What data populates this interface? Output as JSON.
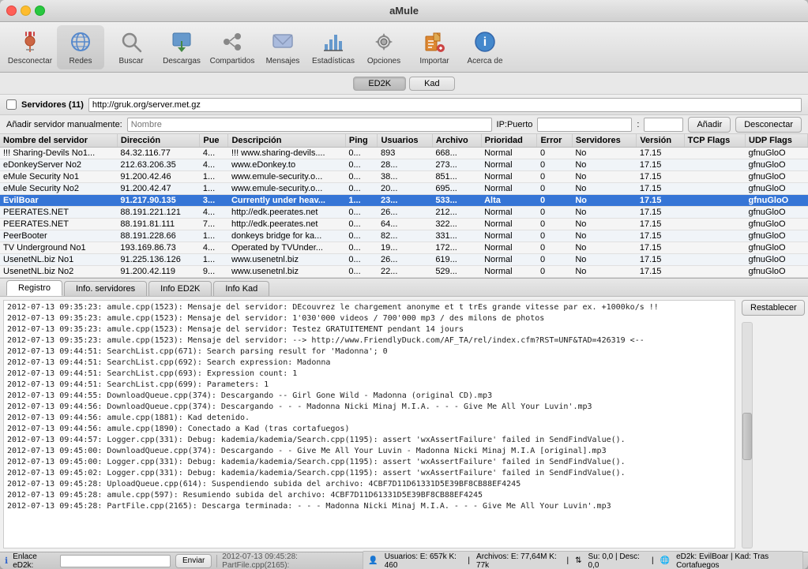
{
  "window": {
    "title": "aMule"
  },
  "toolbar": {
    "buttons": [
      {
        "id": "desconectar",
        "label": "Desconectar",
        "icon": "plug-icon"
      },
      {
        "id": "redes",
        "label": "Redes",
        "icon": "network-icon"
      },
      {
        "id": "buscar",
        "label": "Buscar",
        "icon": "search-icon"
      },
      {
        "id": "descargas",
        "label": "Descargas",
        "icon": "download-icon"
      },
      {
        "id": "compartidos",
        "label": "Compartidos",
        "icon": "shared-icon"
      },
      {
        "id": "mensajes",
        "label": "Mensajes",
        "icon": "messages-icon"
      },
      {
        "id": "estadisticas",
        "label": "Estadísticas",
        "icon": "stats-icon"
      },
      {
        "id": "opciones",
        "label": "Opciones",
        "icon": "options-icon"
      },
      {
        "id": "importar",
        "label": "Importar",
        "icon": "import-icon"
      },
      {
        "id": "acerca",
        "label": "Acerca de",
        "icon": "about-icon"
      }
    ]
  },
  "network": {
    "buttons": [
      "ED2K",
      "Kad"
    ]
  },
  "servers_panel": {
    "title": "Servidores (11)",
    "url_value": "http://gruk.org/server.met.gz",
    "add_label": "Añadir servidor manualmente:",
    "name_placeholder": "Nombre",
    "ip_label": "IP:Puerto",
    "btn_add": "Añadir",
    "btn_disconnect": "Desconectar",
    "columns": [
      "Nombre del servidor",
      "Dirección",
      "Pue",
      "Descripción",
      "Ping",
      "Usuarios",
      "Archivo",
      "Prioridad",
      "Error",
      "Servidores",
      "Versión",
      "TCP Flags",
      "UDP Flags"
    ],
    "rows": [
      {
        "name": "!!! Sharing-Devils No1...",
        "addr": "84.32.116.77",
        "port": "4...",
        "desc": "!!!  www.sharing-devils....",
        "ping": "0...",
        "users": "893",
        "files": "668...",
        "priority": "Normal",
        "error": "0",
        "servers": "No",
        "version": "17.15",
        "tcp": "",
        "udp": "gfnuGloO",
        "bold": false,
        "selected": false
      },
      {
        "name": "eDonkeyServer No2",
        "addr": "212.63.206.35",
        "port": "4...",
        "desc": "www.eDonkey.to",
        "ping": "0...",
        "users": "28...",
        "files": "273...",
        "priority": "Normal",
        "error": "0",
        "servers": "No",
        "version": "17.15",
        "tcp": "",
        "udp": "gfnuGloO",
        "bold": false,
        "selected": false
      },
      {
        "name": "eMule Security No1",
        "addr": "91.200.42.46",
        "port": "1...",
        "desc": "www.emule-security.o...",
        "ping": "0...",
        "users": "38...",
        "files": "851...",
        "priority": "Normal",
        "error": "0",
        "servers": "No",
        "version": "17.15",
        "tcp": "",
        "udp": "gfnuGloO",
        "bold": false,
        "selected": false
      },
      {
        "name": "eMule Security No2",
        "addr": "91.200.42.47",
        "port": "1...",
        "desc": "www.emule-security.o...",
        "ping": "0...",
        "users": "20...",
        "files": "695...",
        "priority": "Normal",
        "error": "0",
        "servers": "No",
        "version": "17.15",
        "tcp": "",
        "udp": "gfnuGloO",
        "bold": false,
        "selected": false
      },
      {
        "name": "EvilBoar",
        "addr": "91.217.90.135",
        "port": "3...",
        "desc": "Currently under heav...",
        "ping": "1...",
        "users": "23...",
        "files": "533...",
        "priority": "Alta",
        "error": "0",
        "servers": "No",
        "version": "17.15",
        "tcp": "",
        "udp": "gfnuGloO",
        "bold": true,
        "selected": true
      },
      {
        "name": "PEERATES.NET",
        "addr": "88.191.221.121",
        "port": "4...",
        "desc": "http://edk.peerates.net",
        "ping": "0...",
        "users": "26...",
        "files": "212...",
        "priority": "Normal",
        "error": "0",
        "servers": "No",
        "version": "17.15",
        "tcp": "",
        "udp": "gfnuGloO",
        "bold": false,
        "selected": false
      },
      {
        "name": "PEERATES.NET",
        "addr": "88.191.81.111",
        "port": "7...",
        "desc": "http://edk.peerates.net",
        "ping": "0...",
        "users": "64...",
        "files": "322...",
        "priority": "Normal",
        "error": "0",
        "servers": "No",
        "version": "17.15",
        "tcp": "",
        "udp": "gfnuGloO",
        "bold": false,
        "selected": false
      },
      {
        "name": "PeerBooter",
        "addr": "88.191.228.66",
        "port": "1...",
        "desc": "donkeys bridge for ka...",
        "ping": "0...",
        "users": "82...",
        "files": "331...",
        "priority": "Normal",
        "error": "0",
        "servers": "No",
        "version": "17.15",
        "tcp": "",
        "udp": "gfnuGloO",
        "bold": false,
        "selected": false
      },
      {
        "name": "TV Underground No1",
        "addr": "193.169.86.73",
        "port": "4...",
        "desc": "Operated by TVUnder...",
        "ping": "0...",
        "users": "19...",
        "files": "172...",
        "priority": "Normal",
        "error": "0",
        "servers": "No",
        "version": "17.15",
        "tcp": "",
        "udp": "gfnuGloO",
        "bold": false,
        "selected": false
      },
      {
        "name": "UsenetNL.biz No1",
        "addr": "91.225.136.126",
        "port": "1...",
        "desc": "www.usenetnl.biz",
        "ping": "0...",
        "users": "26...",
        "files": "619...",
        "priority": "Normal",
        "error": "0",
        "servers": "No",
        "version": "17.15",
        "tcp": "",
        "udp": "gfnuGloO",
        "bold": false,
        "selected": false
      },
      {
        "name": "UsenetNL.biz No2",
        "addr": "91.200.42.119",
        "port": "9...",
        "desc": "www.usenetnl.biz",
        "ping": "0...",
        "users": "22...",
        "files": "529...",
        "priority": "Normal",
        "error": "0",
        "servers": "No",
        "version": "17.15",
        "tcp": "",
        "udp": "gfnuGloO",
        "bold": false,
        "selected": false
      }
    ]
  },
  "bottom_panel": {
    "tabs": [
      "Registro",
      "Info. servidores",
      "Info ED2K",
      "Info Kad"
    ],
    "active_tab": "Registro",
    "btn_reset": "Restablecer",
    "log_lines": [
      "2012-07-13 09:35:23: amule.cpp(1523): Mensaje del servidor: DEcouvrez le chargement anonyme et t trEs grande vitesse par ex. +1000ko/s !!",
      "2012-07-13 09:35:23: amule.cpp(1523): Mensaje del servidor: 1'030'000 videos / 700'000 mp3 / des milons de photos",
      "2012-07-13 09:35:23: amule.cpp(1523): Mensaje del servidor: Testez GRATUITEMENT pendant 14 jours",
      "2012-07-13 09:35:23: amule.cpp(1523): Mensaje del servidor: --> http://www.FriendlyDuck.com/AF_TA/rel/index.cfm?RST=UNF&TAD=426319 <--",
      "2012-07-13 09:44:51: SearchList.cpp(671): Search parsing result for 'Madonna'; 0",
      "2012-07-13 09:44:51: SearchList.cpp(692): Search expression: Madonna",
      "2012-07-13 09:44:51: SearchList.cpp(693): Expression count: 1",
      "2012-07-13 09:44:51: SearchList.cpp(699): Parameters: 1",
      "2012-07-13 09:44:55: DownloadQueue.cpp(374): Descargando -- Girl Gone Wild - Madonna (original CD).mp3",
      "2012-07-13 09:44:56: DownloadQueue.cpp(374): Descargando - - - Madonna Nicki Minaj M.I.A. - - - Give Me All Your Luvin'.mp3",
      "2012-07-13 09:44:56: amule.cpp(1881): Kad detenido.",
      "2012-07-13 09:44:56: amule.cpp(1890): Conectado a Kad (tras cortafuegos)",
      "2012-07-13 09:44:57: Logger.cpp(331): Debug: kademia/kademia/Search.cpp(1195): assert 'wxAssertFailure' failed in SendFindValue().",
      "2012-07-13 09:45:00: DownloadQueue.cpp(374): Descargando - - Give Me All Your Luvin - Madonna Nicki Minaj M.I.A [original].mp3",
      "2012-07-13 09:45:00: Logger.cpp(331): Debug: kademia/kademia/Search.cpp(1195): assert 'wxAssertFailure' failed in SendFindValue().",
      "2012-07-13 09:45:02: Logger.cpp(331): Debug: kademia/kademia/Search.cpp(1195): assert 'wxAssertFailure' failed in SendFindValue().",
      "2012-07-13 09:45:28: UploadQueue.cpp(614): Suspendiendo subida del archivo: 4CBF7D11D61331D5E39BF8CB88EF4245",
      "2012-07-13 09:45:28: amule.cpp(597): Resumiendo subida del archivo: 4CBF7D11D61331D5E39BF8CB88EF4245",
      "2012-07-13 09:45:28: PartFile.cpp(2165): Descarga terminada: - - - Madonna Nicki Minaj M.I.A. - - - Give Me All Your Luvin'.mp3"
    ]
  },
  "status_bar": {
    "link_label": "Enlace eD2k:",
    "btn_send": "Enviar",
    "last_log": "2012-07-13 09:45:28: PartFile.cpp(2165):",
    "users_label": "Usuarios: E: 657k K: 460",
    "files_label": "Archivos: E: 77,64M K: 77k",
    "su_label": "Su: 0,0 | Desc: 0,0",
    "server_label": "eD2k: EvilBoar | Kad: Tras Cortafuegos"
  }
}
